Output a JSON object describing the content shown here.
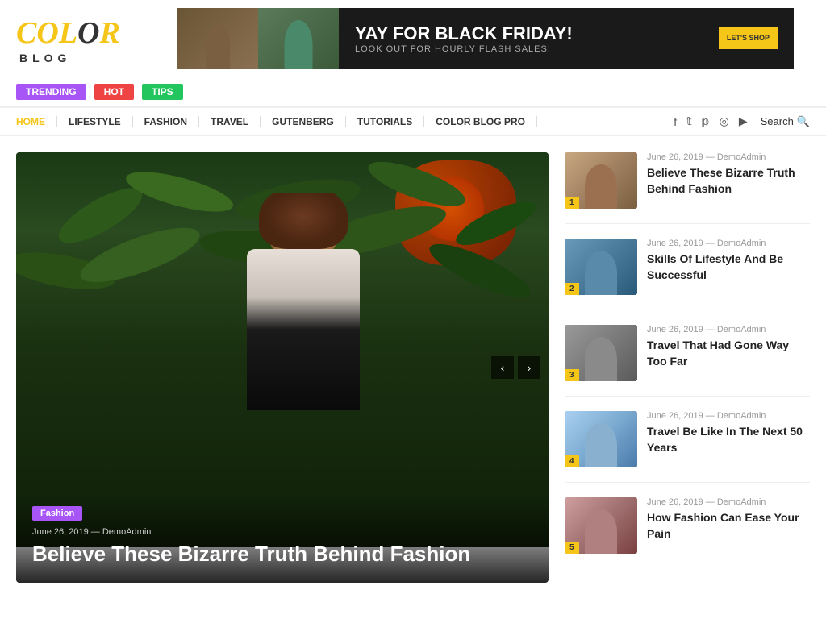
{
  "logo": {
    "color_text": "COLOR",
    "blog_text": "BLOG"
  },
  "banner": {
    "main_text": "YAY FOR BLACK FRIDAY!",
    "sub_text": "LOOK OUT FOR HOURLY FLASH SALES!",
    "btn_text": "LET'S SHOP"
  },
  "tags": [
    {
      "label": "TRENDING",
      "class": "tag-trending"
    },
    {
      "label": "HOT",
      "class": "tag-hot"
    },
    {
      "label": "TIPS",
      "class": "tag-tips"
    }
  ],
  "nav": {
    "items": [
      "HOME",
      "LIFESTYLE",
      "FASHION",
      "TRAVEL",
      "GUTENBERG",
      "TUTORIALS",
      "COLOR BLOG PRO"
    ],
    "search_label": "Search"
  },
  "featured": {
    "tag": "Fashion",
    "date": "June 26, 2019",
    "author": "DemoAdmin",
    "title": "Believe These Bizarre Truth Behind Fashion"
  },
  "sidebar": {
    "items": [
      {
        "num": "1",
        "date": "June 26, 2019",
        "author": "DemoAdmin",
        "title": "Believe These Bizarre Truth Behind Fashion",
        "thumb_class": "thumb-1"
      },
      {
        "num": "2",
        "date": "June 26, 2019",
        "author": "DemoAdmin",
        "title": "Skills Of Lifestyle And Be Successful",
        "thumb_class": "thumb-2"
      },
      {
        "num": "3",
        "date": "June 26, 2019",
        "author": "DemoAdmin",
        "title": "Travel That Had Gone Way Too Far",
        "thumb_class": "thumb-3"
      },
      {
        "num": "4",
        "date": "June 26, 2019",
        "author": "DemoAdmin",
        "title": "Travel Be Like In The Next 50 Years",
        "thumb_class": "thumb-4"
      },
      {
        "num": "5",
        "date": "June 26, 2019",
        "author": "DemoAdmin",
        "title": "How Fashion Can Ease Your Pain",
        "thumb_class": "thumb-5"
      }
    ]
  },
  "social": {
    "icons": [
      "f",
      "𝕪",
      "℗",
      "◎",
      "▶"
    ]
  }
}
